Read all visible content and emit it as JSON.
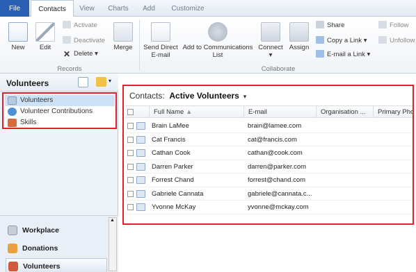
{
  "tabs": [
    "File",
    "Contacts",
    "View",
    "Charts",
    "Add",
    "Customize"
  ],
  "ribbon": {
    "new": "New",
    "edit": "Edit",
    "activate": "Activate",
    "deactivate": "Deactivate",
    "delete": "Delete",
    "merge": "Merge",
    "send_email_1": "Send Direct",
    "send_email_2": "E-mail",
    "add_comm_1": "Add to Communications",
    "add_comm_2": "List",
    "connect": "Connect",
    "assign": "Assign",
    "share": "Share",
    "copy_link": "Copy a Link",
    "email_link": "E-mail a Link",
    "follow": "Follow",
    "unfollow": "Unfollow",
    "group_records": "Records",
    "group_collaborate": "Collaborate"
  },
  "nav": {
    "title": "Volunteers",
    "items": [
      "Volunteers",
      "Volunteer Contributions",
      "Skills"
    ],
    "areas": [
      "Workplace",
      "Donations",
      "Volunteers"
    ]
  },
  "view": {
    "entity": "Contacts:",
    "name": "Active Volunteers"
  },
  "grid": {
    "columns": [
      "Full Name",
      "E-mail",
      "Organisation ...",
      "Primary Phone"
    ],
    "rows": [
      {
        "name": "Brain LaMee",
        "email": "brain@lamee.com"
      },
      {
        "name": "Cat Francis",
        "email": "cat@francis.com"
      },
      {
        "name": "Cathan Cook",
        "email": "cathan@cook.com"
      },
      {
        "name": "Darren Parker",
        "email": "darren@parker.com"
      },
      {
        "name": "Forrest Chand",
        "email": "forrest@chand.com"
      },
      {
        "name": "Gabriele Cannata",
        "email": "gabriele@cannata.c..."
      },
      {
        "name": "Yvonne McKay",
        "email": "yvonne@mckay.com"
      }
    ]
  },
  "colors": {
    "accent": "#2a60b4",
    "highlight": "#e0202a",
    "selection": "#cde1f7"
  }
}
